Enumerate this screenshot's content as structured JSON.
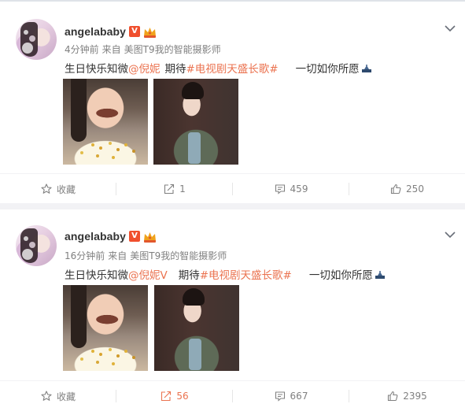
{
  "posts": [
    {
      "username": "angelababy",
      "vip_badge": "V",
      "time": "4分钟前",
      "source_prefix": "来自",
      "source": "美图T9我的智能摄影师",
      "text": {
        "intro": "生日快乐知微",
        "mention": "@倪妮",
        "mention_suffix": "",
        "expect": "期待",
        "topic": "#电视剧天盛长歌#",
        "wish": "一切如你所愿"
      },
      "actions": {
        "favorite": "收藏",
        "repost": "1",
        "comment": "459",
        "like": "250"
      }
    },
    {
      "username": "angelababy",
      "vip_badge": "V",
      "time": "16分钟前",
      "source_prefix": "来自",
      "source": "美图T9我的智能摄影师",
      "text": {
        "intro": "生日快乐知微",
        "mention": "@倪妮",
        "mention_suffix": "V",
        "expect": "期待",
        "topic": "#电视剧天盛长歌#",
        "wish": "一切如你所愿"
      },
      "actions": {
        "favorite": "收藏",
        "repost": "56",
        "comment": "667",
        "like": "2395"
      }
    }
  ],
  "icons": {
    "avatar": "avatar",
    "vip": "vip-badge",
    "crown": "crown-icon",
    "sparkle": "sparkle-icon",
    "more": "chevron-down-icon",
    "favorite": "star-icon",
    "repost": "repost-icon",
    "comment": "comment-icon",
    "like": "thumbs-up-icon"
  },
  "colors": {
    "link": "#eb7350",
    "muted": "#808080",
    "text": "#333333",
    "vip": "#f04f2d",
    "divider": "#f2f2f5"
  }
}
